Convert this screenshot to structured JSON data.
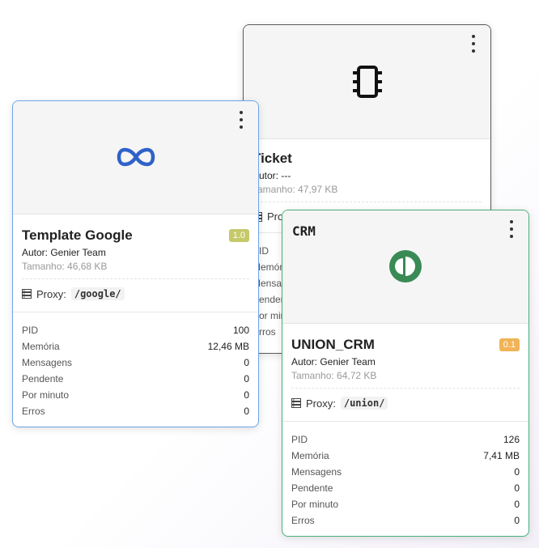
{
  "colors": {
    "template_border": "#6fa3e6",
    "crm_border": "#48b07a",
    "ticket_border": "#5a5a5a",
    "infinity_blue": "#2f62c9",
    "crm_green": "#3a8a55",
    "badge_olive": "#c5c96a",
    "badge_orange": "#f0b357"
  },
  "ticket_card": {
    "icon": "chip-icon",
    "title": "Ticket",
    "author": "Autor: ---",
    "size": "Tamanho: 47,97 KB",
    "proxy_label": "Proxy:",
    "stats_labels": [
      "PID",
      "Memória",
      "Mensagens",
      "Pendente",
      "Por minuto",
      "Erros"
    ]
  },
  "template_card": {
    "icon": "infinity-icon",
    "title": "Template Google",
    "version": "1.0",
    "author": "Autor: Genier Team",
    "size": "Tamanho: 46,68 KB",
    "proxy_label": "Proxy:",
    "proxy_path": "/google/",
    "stats": [
      {
        "label": "PID",
        "value": "100"
      },
      {
        "label": "Memória",
        "value": "12,46 MB"
      },
      {
        "label": "Mensagens",
        "value": "0"
      },
      {
        "label": "Pendente",
        "value": "0"
      },
      {
        "label": "Por minuto",
        "value": "0"
      },
      {
        "label": "Erros",
        "value": "0"
      }
    ]
  },
  "crm_card": {
    "header_text": "CRM",
    "icon": "crm-logo-icon",
    "title": "UNION_CRM",
    "version": "0.1",
    "author": "Autor: Genier Team",
    "size": "Tamanho: 64,72 KB",
    "proxy_label": "Proxy:",
    "proxy_path": "/union/",
    "stats": [
      {
        "label": "PID",
        "value": "126"
      },
      {
        "label": "Memória",
        "value": "7,41 MB"
      },
      {
        "label": "Mensagens",
        "value": "0"
      },
      {
        "label": "Pendente",
        "value": "0"
      },
      {
        "label": "Por minuto",
        "value": "0"
      },
      {
        "label": "Erros",
        "value": "0"
      }
    ]
  }
}
